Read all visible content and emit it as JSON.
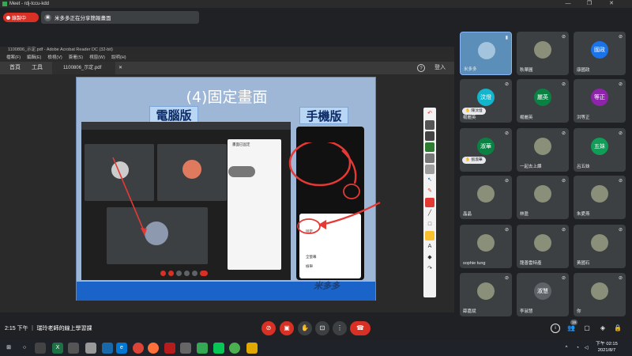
{
  "window": {
    "title": "Meet - rdj-tccu-kdd"
  },
  "meet_top": {
    "recording_label": "錄製中",
    "presenting_text": "米多多正在分享簡報畫面"
  },
  "acrobat": {
    "window_title": "1100806_示定.pdf - Adobe Acrobat Reader DC (32-bit)",
    "menu": [
      "檔案(F)",
      "編輯(E)",
      "檢視(V)",
      "簽署(S)",
      "視窗(W)",
      "說明(H)"
    ],
    "tabs": {
      "home": "首頁",
      "tools": "工具",
      "document": "1100806_示定.pdf"
    },
    "help_icon": "question-circle-icon",
    "sign_in": "登入"
  },
  "slide": {
    "title": "(4)固定畫面",
    "pc_label": "電腦版",
    "phone_label": "手機版",
    "dialog_title": "畫面已固定",
    "menu_item": "固定",
    "menu_item2": "全螢幕",
    "menu_item3": "檢舉",
    "watermark": "米多多"
  },
  "participants": [
    {
      "name": "米多多",
      "type": "video",
      "mic": "mic-icon",
      "hand": ""
    },
    {
      "name": "秋華圓",
      "type": "video",
      "mic": "mic-off-icon",
      "hand": ""
    },
    {
      "name": "康國政",
      "type": "avatar",
      "initials": "國政",
      "color": "#1a73e8",
      "mic": "mic-off-icon",
      "hand": ""
    },
    {
      "name": "楊麗英",
      "type": "avatar",
      "initials": "汶燈",
      "color": "#12b5cb",
      "mic": "mic-off-icon",
      "hand": "陳汶燈"
    },
    {
      "name": "楊麗英",
      "type": "avatar",
      "initials": "麗英",
      "color": "#0b8043",
      "mic": "mic-off-icon",
      "hand": ""
    },
    {
      "name": "洪等正",
      "type": "avatar",
      "initials": "等正",
      "color": "#8e24aa",
      "mic": "mic-off-icon",
      "hand": ""
    },
    {
      "name": "",
      "type": "avatar",
      "initials": "淑華",
      "color": "#0b8043",
      "mic": "mic-off-icon",
      "hand": "張淑華"
    },
    {
      "name": "一起去上課",
      "type": "video",
      "mic": "mic-off-icon",
      "hand": ""
    },
    {
      "name": "呂五妹",
      "type": "avatar",
      "initials": "五妹",
      "color": "#0f9d58",
      "mic": "mic-off-icon",
      "hand": ""
    },
    {
      "name": "晶晶",
      "type": "video",
      "mic": "mic-off-icon",
      "hand": ""
    },
    {
      "name": "林盈",
      "type": "video",
      "mic": "mic-off-icon",
      "hand": ""
    },
    {
      "name": "朱愛燕",
      "type": "video",
      "mic": "mic-off-icon",
      "hand": ""
    },
    {
      "name": "sophie tung",
      "type": "video",
      "mic": "mic-off-icon",
      "hand": ""
    },
    {
      "name": "龍善雲特產",
      "type": "video",
      "mic": "mic-off-icon",
      "hand": ""
    },
    {
      "name": "黃國石",
      "type": "video",
      "mic": "mic-off-icon",
      "hand": ""
    },
    {
      "name": "薛嘉斌",
      "type": "video",
      "mic": "mic-off-icon",
      "hand": ""
    },
    {
      "name": "李淑慧",
      "type": "avatar",
      "initials": "淑慧",
      "color": "#5f6368",
      "mic": "mic-off-icon",
      "hand": ""
    },
    {
      "name": "你",
      "type": "video",
      "mic": "mic-off-icon",
      "hand": ""
    }
  ],
  "bottom": {
    "time_meeting": "2:15 下午 ｜ 瑞玲老師的線上學習課",
    "participant_count": "19"
  },
  "taskbar": {
    "clock_time": "下午 02:15",
    "clock_date": "2021/8/7"
  }
}
